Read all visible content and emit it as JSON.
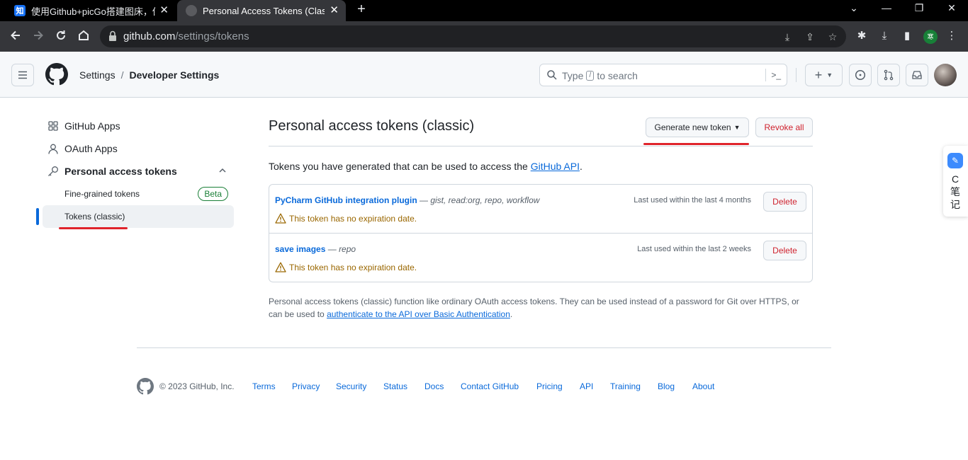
{
  "browser": {
    "tabs": [
      {
        "favicon": "知",
        "title": "使用Github+picGo搭建图床，保",
        "close": "✕"
      },
      {
        "favicon": "",
        "title": "Personal Access Tokens (Classic)",
        "close": "✕"
      }
    ],
    "new_tab": "+",
    "window_controls": [
      "⌄",
      "—",
      "❐",
      "✕"
    ],
    "url_host": "github.com",
    "url_path": "/settings/tokens",
    "profile_initial": "寒"
  },
  "header": {
    "breadcrumb": {
      "settings": "Settings",
      "separator": "/",
      "developer_settings": "Developer Settings"
    },
    "search": {
      "prefix": "Type",
      "key": "/",
      "suffix": "to search"
    }
  },
  "sidebar": {
    "items": [
      {
        "label": "GitHub Apps"
      },
      {
        "label": "OAuth Apps"
      },
      {
        "label": "Personal access tokens"
      }
    ],
    "subitems": [
      {
        "label": "Fine-grained tokens",
        "badge": "Beta"
      },
      {
        "label": "Tokens (classic)"
      }
    ]
  },
  "main": {
    "title": "Personal access tokens (classic)",
    "generate_button": "Generate new token",
    "revoke_button": "Revoke all",
    "intro_text": "Tokens you have generated that can be used to access the ",
    "intro_link": "GitHub API",
    "intro_end": ".",
    "tokens": [
      {
        "name": "PyCharm GitHub integration plugin",
        "dash": " — ",
        "scopes": "gist, read:org, repo, workflow",
        "warning": "This token has no expiration date.",
        "last_used": "Last used within the last 4 months",
        "delete": "Delete"
      },
      {
        "name": "save images",
        "dash": " — ",
        "scopes": "repo",
        "warning": "This token has no expiration date.",
        "last_used": "Last used within the last 2 weeks",
        "delete": "Delete"
      }
    ],
    "footnote_text": "Personal access tokens (classic) function like ordinary OAuth access tokens. They can be used instead of a password for Git over HTTPS, or can be used to ",
    "footnote_link": "authenticate to the API over Basic Authentication",
    "footnote_end": "."
  },
  "footer": {
    "copyright": "© 2023 GitHub, Inc.",
    "links": [
      "Terms",
      "Privacy",
      "Security",
      "Status",
      "Docs",
      "Contact GitHub",
      "Pricing",
      "API",
      "Training",
      "Blog",
      "About"
    ]
  },
  "float_widget": {
    "text": "C 笔 记"
  },
  "colors": {
    "accent": "#0969da",
    "danger": "#cf222e",
    "success": "#1a7f37",
    "warning": "#9a6700",
    "annotation": "#e0242b"
  }
}
